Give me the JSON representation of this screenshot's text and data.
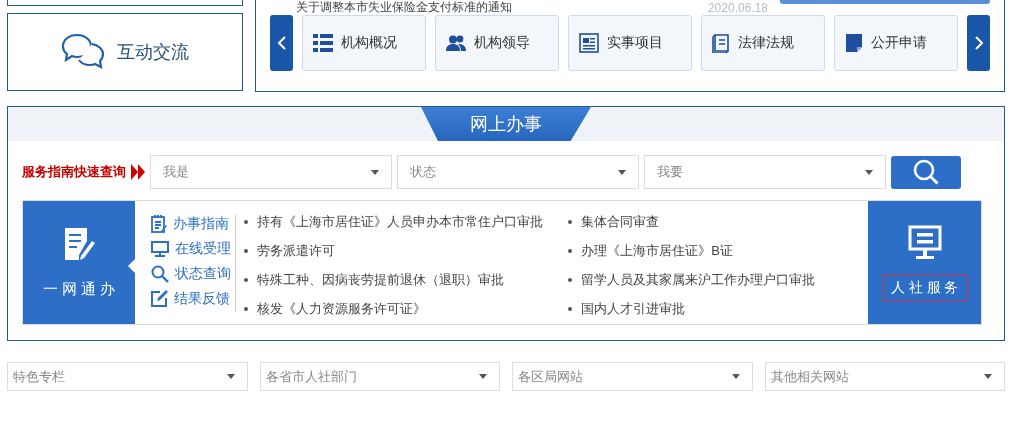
{
  "news": {
    "title": "关于调整本市失业保险金支付标准的通知",
    "date": "2020.06.18"
  },
  "left_card": {
    "label": "互动交流"
  },
  "nav": {
    "items": [
      {
        "label": "机构概况",
        "kind": "list"
      },
      {
        "label": "机构领导",
        "kind": "people"
      },
      {
        "label": "实事项目",
        "kind": "document"
      },
      {
        "label": "法律法规",
        "kind": "book"
      },
      {
        "label": "公开申请",
        "kind": "note"
      }
    ]
  },
  "online_service": {
    "title": "网上办事",
    "quick_search": {
      "label": "服务指南快速查询",
      "fields": [
        {
          "placeholder": "我是"
        },
        {
          "placeholder": "状态"
        },
        {
          "placeholder": "我要"
        }
      ]
    },
    "one_network": {
      "label": "一 网 通 办",
      "links": [
        {
          "label": "办事指南",
          "kind": "guide"
        },
        {
          "label": "在线受理",
          "kind": "monitor"
        },
        {
          "label": "状态查询",
          "kind": "search"
        },
        {
          "label": "结果反馈",
          "kind": "edit"
        }
      ],
      "services": [
        "持有《上海市居住证》人员申办本市常住户口审批",
        "集体合同审查",
        "劳务派遣许可",
        "办理《上海市居住证》B证",
        "特殊工种、因病丧劳提前退休（退职）审批",
        "留学人员及其家属来沪工作办理户口审批",
        "核发《人力资源服务许可证》",
        "国内人才引进审批"
      ]
    },
    "hr_service": {
      "label": "人 社 服 务"
    }
  },
  "footer_selects": [
    {
      "placeholder": "特色专栏"
    },
    {
      "placeholder": "各省市人社部门"
    },
    {
      "placeholder": "各区局网站"
    },
    {
      "placeholder": "其他相关网站"
    }
  ]
}
